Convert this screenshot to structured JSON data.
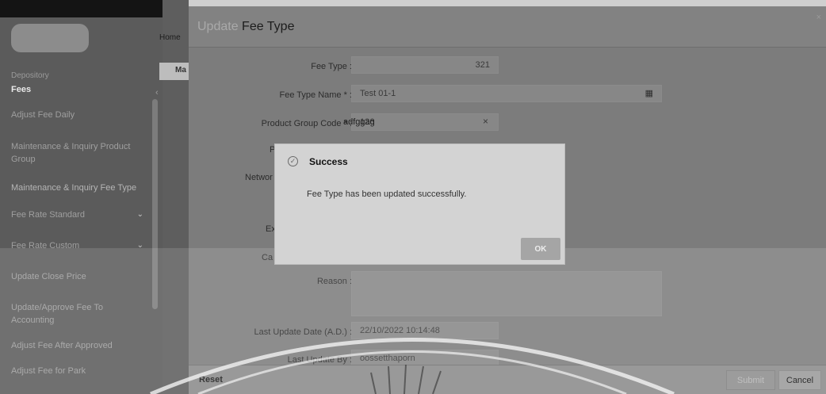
{
  "sidebar": {
    "section": "Depository",
    "title": "Fees",
    "items": [
      {
        "label": "Adjust Fee Daily"
      },
      {
        "label": "Maintenance & Inquiry Product Group"
      },
      {
        "label": "Maintenance & Inquiry Fee Type"
      },
      {
        "label": "Fee Rate Standard"
      },
      {
        "label": "Fee Rate Custom"
      },
      {
        "label": "Update Close Price"
      },
      {
        "label": "Update/Approve Fee To Accounting"
      },
      {
        "label": "Adjust Fee After Approved"
      },
      {
        "label": "Adjust Fee for Park"
      }
    ]
  },
  "background": {
    "home_label": "Home",
    "tab_label": "Ma"
  },
  "panel": {
    "title_prefix": "Update",
    "title_main": "Fee Type",
    "fields": {
      "fee_type_label": "Fee Type :",
      "fee_type_value": "321",
      "fee_type_name_label": "Fee Type Name * :",
      "fee_type_name_value": "Test 01-1",
      "product_group_code_label": "Product Group Code * :",
      "product_group_code_value": "126",
      "product_group_desc": "adfggag",
      "partial_label_p": "P",
      "partial_label_network": "Networ",
      "partial_label_ex": "Ex",
      "partial_label_ca": "Ca",
      "reason_label": "Reason :",
      "last_update_date_label": "Last Update Date (A.D.) :",
      "last_update_date_value": "22/10/2022 10:14:48",
      "last_update_by_label": "Last Update By :",
      "last_update_by_value": "oossetthaporn"
    },
    "buttons": {
      "reset": "Reset",
      "submit": "Submit",
      "cancel": "Cancel",
      "close": "×"
    }
  },
  "dialog": {
    "title": "Success",
    "message": "Fee Type has been updated successfully.",
    "ok": "OK",
    "icon": "check-circle-icon"
  }
}
